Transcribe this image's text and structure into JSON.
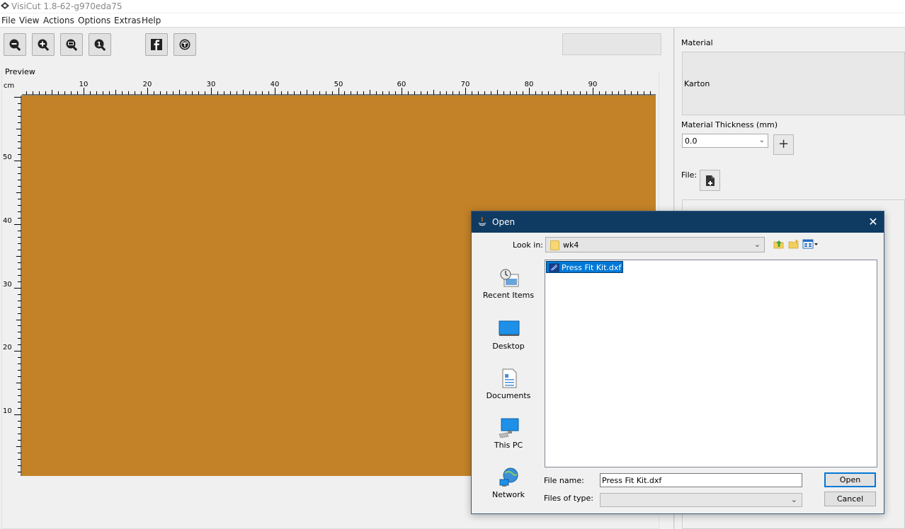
{
  "app": {
    "title": "VisiCut 1.8-62-g970eda75"
  },
  "menu": [
    "File",
    "View",
    "Actions",
    "Options",
    "Extras",
    "Help"
  ],
  "toolbar": {
    "buttons": [
      "zoom-out-icon",
      "zoom-in-icon",
      "zoom-fit-icon",
      "zoom-actual-icon",
      "facebook-icon",
      "thingiverse-icon"
    ]
  },
  "preview": {
    "label": "Preview",
    "unit": "cm",
    "board_color": "#c38228",
    "x_ticks": [
      "10",
      "20",
      "30",
      "40",
      "50",
      "60",
      "70",
      "80",
      "90"
    ],
    "y_ticks": [
      "50",
      "40",
      "30",
      "20",
      "10"
    ]
  },
  "panel": {
    "material_label": "Material",
    "material_value": "Karton",
    "thickness_label": "Material Thickness (mm)",
    "thickness_value": "0.0",
    "thickness_add": "+",
    "file_label": "File:"
  },
  "dialog": {
    "title": "Open",
    "look_in_label": "Look in:",
    "look_in_value": "wk4",
    "places": [
      "Recent Items",
      "Desktop",
      "Documents",
      "This PC",
      "Network"
    ],
    "files": [
      "Press Fit Kit.dxf"
    ],
    "file_name_label": "File name:",
    "file_name_value": "Press Fit Kit.dxf",
    "file_type_label": "Files of type:",
    "file_type_value": "",
    "open_button": "Open",
    "cancel_button": "Cancel",
    "accent": "#0f3b63",
    "selection_color": "#0078d7"
  }
}
